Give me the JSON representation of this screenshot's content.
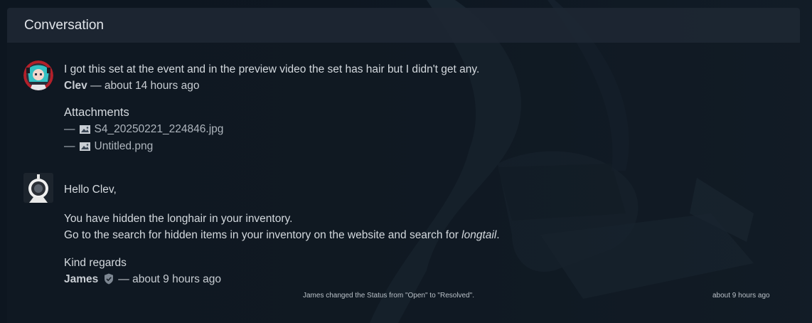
{
  "panel": {
    "title": "Conversation"
  },
  "messages": [
    {
      "author": "Clev",
      "time": "about 14 hours ago",
      "text": "I got this set at the event and in the preview video the set has hair but I didn't get any.",
      "attachments_title": "Attachments",
      "attachments": [
        {
          "dash": "—",
          "name": "S4_20250221_224846.jpg",
          "icon": "image-icon"
        },
        {
          "dash": "—",
          "name": "Untitled.png",
          "icon": "image-icon"
        }
      ]
    },
    {
      "author": "James",
      "time": "about 9 hours ago",
      "greeting": "Hello Clev,",
      "line1": "You have hidden the longhair in your inventory.",
      "line2_prefix": "Go to the search for hidden items in your inventory on the website and search for ",
      "line2_em": "longtail",
      "line2_suffix": ".",
      "closing": "Kind regards",
      "badge_icon": "shield-check-icon"
    }
  ],
  "separator": "—",
  "status_event": {
    "text": "James changed the Status from \"Open\" to \"Resolved\".",
    "time": "about 9 hours ago"
  },
  "colors": {
    "background": "#0d1620",
    "header": "#1e2834",
    "text": "#d4d9de"
  }
}
